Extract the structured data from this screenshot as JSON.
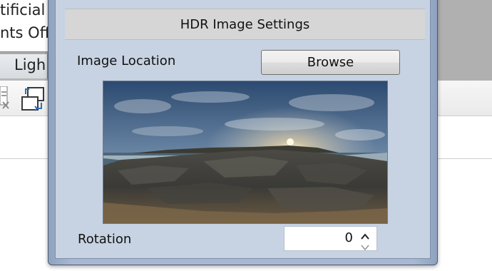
{
  "background_app": {
    "line1": "tificial",
    "line2": "nts Off",
    "tab_label": "Ligh",
    "icons": [
      "delete-item-icon",
      "swap-views-icon"
    ]
  },
  "dialog": {
    "section_title": "HDR Image Settings",
    "image_location_label": "Image Location",
    "browse_label": "Browse",
    "preview": "hdr-panorama-preview",
    "rotation_label": "Rotation",
    "rotation_value": "0"
  },
  "colors": {
    "dialog_frame": "#a8b8d0",
    "dialog_client": "#c7d3e2",
    "section_header": "#d6d6d6",
    "tab_bar": "#b0b0b0"
  }
}
